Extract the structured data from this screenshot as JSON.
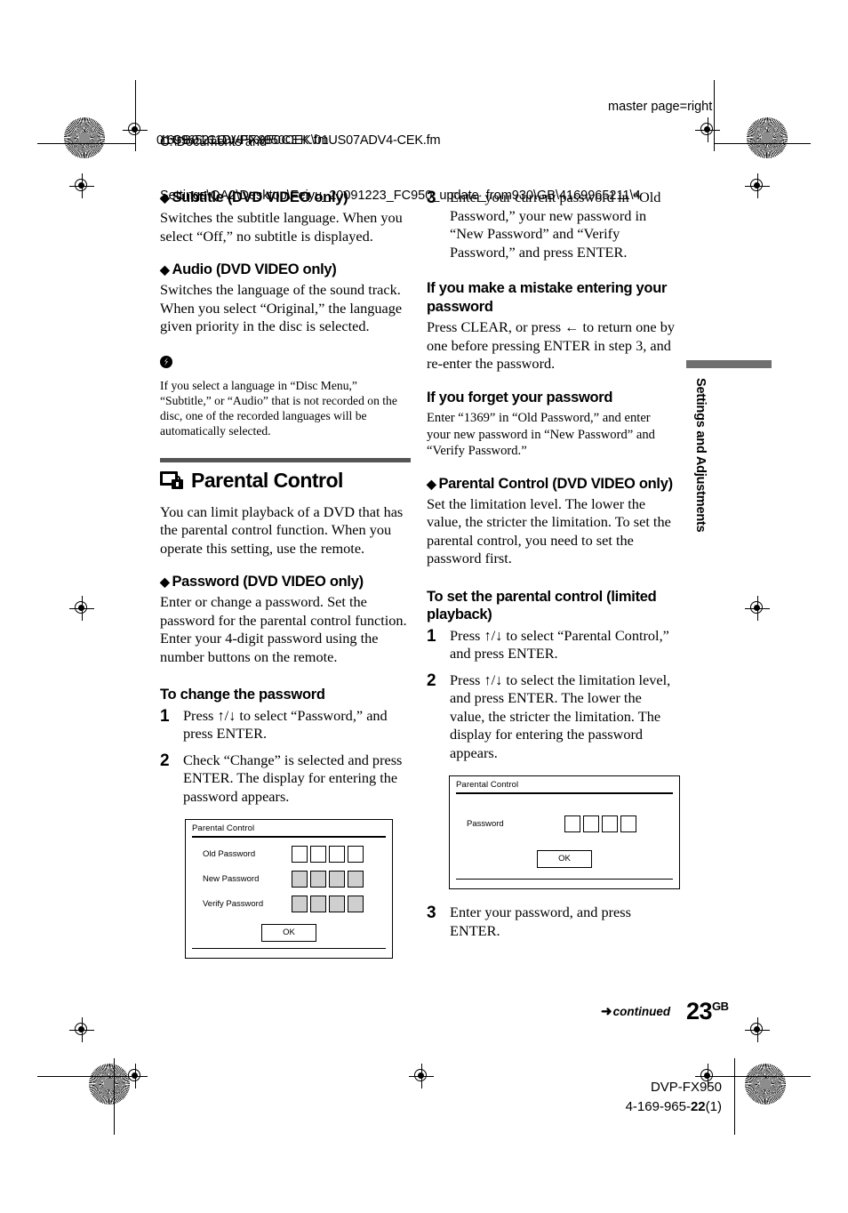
{
  "header": {
    "path_line1": "C:\\Documents and",
    "path_line2": "Settings\\QA2\\Desktop\\Feiyu_20091223_FC950_update_from930\\GB\\4169965211\\4",
    "overlap_line_a": "169965211DVPFX950CEK\\01US07ADV4-CEK.fm",
    "overlap_line_b": "01GB01COV-FX950CEK.fm",
    "master_page": "master page=right"
  },
  "left_column": {
    "subtitle_section": {
      "heading": "Subtitle (DVD VIDEO only)",
      "body": "Switches the subtitle language.\nWhen you select “Off,” no subtitle is displayed."
    },
    "audio_section": {
      "heading": "Audio (DVD VIDEO only)",
      "body": "Switches the language of the sound track.\nWhen you select “Original,” the language given priority in the disc is selected."
    },
    "note": {
      "icon": "note-icon",
      "text": "If you select a language in “Disc Menu,” “Subtitle,” or “Audio” that is not recorded on the disc, one of the recorded languages will be automatically selected."
    },
    "parental_section": {
      "icon": "screen-lock-icon",
      "heading": "Parental Control",
      "body": "You can limit playback of a DVD that has the parental control function.\nWhen you operate this setting, use the remote."
    },
    "password_section": {
      "heading": "Password (DVD VIDEO only)",
      "body": "Enter or change a password. Set the password for the parental control function. Enter your 4-digit password using the number buttons on the remote."
    },
    "change_password": {
      "heading": "To change the password",
      "steps": [
        {
          "num": "1",
          "text": "Press ↑/↓ to select “Password,” and press ENTER."
        },
        {
          "num": "2",
          "text": "Check “Change” is selected and press ENTER.\nThe display for entering the password appears."
        }
      ]
    },
    "osd_change": {
      "title": "Parental Control",
      "rows": [
        {
          "label": "Old Password",
          "boxes": 4,
          "filled": false
        },
        {
          "label": "New Password",
          "boxes": 4,
          "filled": true
        },
        {
          "label": "Verify Password",
          "boxes": 4,
          "filled": true
        }
      ],
      "ok_label": "OK"
    }
  },
  "right_column": {
    "step3": {
      "num": "3",
      "text": "Enter your current password in “Old Password,” your new password in “New Password” and “Verify Password,” and press ENTER."
    },
    "mistake_section": {
      "heading": "If you make a mistake entering your password",
      "body": "Press CLEAR, or press ← to return one by one before pressing ENTER in step 3, and re-enter the password."
    },
    "forgot_section": {
      "heading": "If you forget your password",
      "body": "Enter “1369” in “Old Password,” and enter your new password in “New Password” and “Verify Password.”"
    },
    "parental_control_section": {
      "heading": "Parental Control (DVD VIDEO only)",
      "body": "Set the limitation level. The lower the value, the stricter the limitation.\nTo set the parental control, you need to set the password first."
    },
    "set_parental": {
      "heading": "To set the parental control (limited playback)",
      "steps": [
        {
          "num": "1",
          "text": "Press ↑/↓ to select “Parental Control,” and press ENTER."
        },
        {
          "num": "2",
          "text": "Press ↑/↓ to select the limitation level, and press ENTER. The lower the value, the stricter the limitation.\nThe display for entering the password appears."
        }
      ]
    },
    "osd_password": {
      "title": "Parental Control",
      "rows": [
        {
          "label": "Password",
          "boxes": 4,
          "filled": false
        }
      ],
      "ok_label": "OK"
    },
    "step3_final": {
      "num": "3",
      "text": "Enter your password, and press ENTER."
    }
  },
  "side_tab": {
    "label": "Settings and Adjustments"
  },
  "footer": {
    "continued": "continued",
    "continued_arrow": "➜",
    "page_number": "23",
    "page_suffix": "GB",
    "model": "DVP-FX950",
    "part_prefix": "4-169-965-",
    "part_bold": "22",
    "part_suffix": "(1)"
  }
}
